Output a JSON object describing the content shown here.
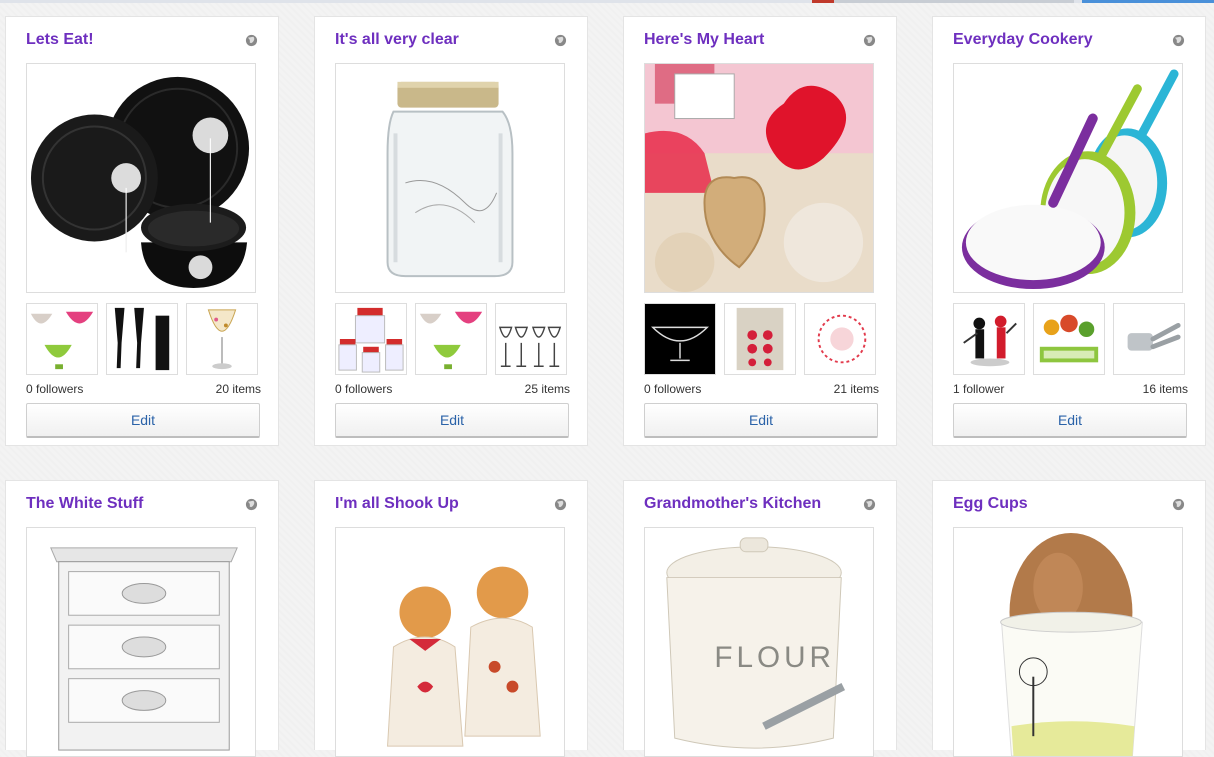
{
  "boards": [
    {
      "title": "Lets Eat!",
      "followers": "0 followers",
      "items": "20 items",
      "edit": "Edit",
      "cover_icon": "dinnerware-set",
      "thumb_icons": [
        "glass-bowls",
        "black-flutes",
        "gold-wine-glass"
      ]
    },
    {
      "title": "It's all very clear",
      "followers": "0 followers",
      "items": "25 items",
      "edit": "Edit",
      "cover_icon": "glass-jar",
      "thumb_icons": [
        "red-lid-jars",
        "glass-bowls",
        "wine-glasses"
      ]
    },
    {
      "title": "Here's My Heart",
      "followers": "0 followers",
      "items": "21 items",
      "edit": "Edit",
      "cover_icon": "heart-cookie",
      "thumb_icons": [
        "wire-bowl",
        "heart-buttons",
        "heart-picks"
      ]
    },
    {
      "title": "Everyday Cookery",
      "followers": "1 follower",
      "items": "16 items",
      "edit": "Edit",
      "cover_icon": "frying-pans",
      "thumb_icons": [
        "knife-block",
        "veg-slicer",
        "garlic-press"
      ]
    },
    {
      "title": "The White Stuff",
      "cover_icon": "white-drawers"
    },
    {
      "title": "I'm all Shook Up",
      "cover_icon": "gingerbread-shakers"
    },
    {
      "title": "Grandmother's Kitchen",
      "cover_icon": "flour-canister"
    },
    {
      "title": "Egg Cups",
      "cover_icon": "egg-cup"
    }
  ],
  "colors": {
    "title": "#6e2fbf",
    "edit_text": "#2a62a8",
    "background": "#f3f3f3"
  }
}
